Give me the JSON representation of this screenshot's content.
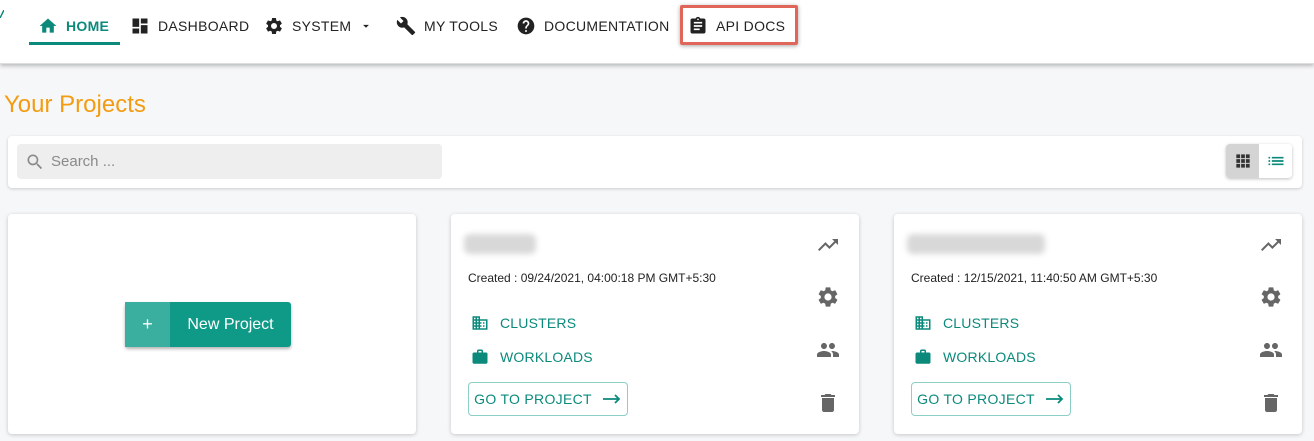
{
  "nav": {
    "items": [
      {
        "label": "HOME",
        "icon": "home-icon"
      },
      {
        "label": "DASHBOARD",
        "icon": "dashboard-icon"
      },
      {
        "label": "SYSTEM",
        "icon": "gear-icon"
      },
      {
        "label": "MY TOOLS",
        "icon": "wrench-icon"
      },
      {
        "label": "DOCUMENTATION",
        "icon": "help-icon"
      },
      {
        "label": "API DOCS",
        "icon": "clipboard-icon"
      }
    ]
  },
  "page": {
    "title": "Your Projects"
  },
  "search": {
    "placeholder": "Search ...",
    "value": ""
  },
  "new_project": {
    "plus": "+",
    "label": "New Project"
  },
  "projects": [
    {
      "created": "Created : 09/24/2021, 04:00:18 PM GMT+5:30",
      "clusters_label": "CLUSTERS",
      "workloads_label": "WORKLOADS",
      "goto_label": "GO TO PROJECT"
    },
    {
      "created": "Created : 12/15/2021, 11:40:50 AM GMT+5:30",
      "clusters_label": "CLUSTERS",
      "workloads_label": "WORKLOADS",
      "goto_label": "GO TO PROJECT"
    }
  ],
  "colors": {
    "accent": "#0b8a7c",
    "title": "#f39c12",
    "highlight": "#e0665a"
  }
}
